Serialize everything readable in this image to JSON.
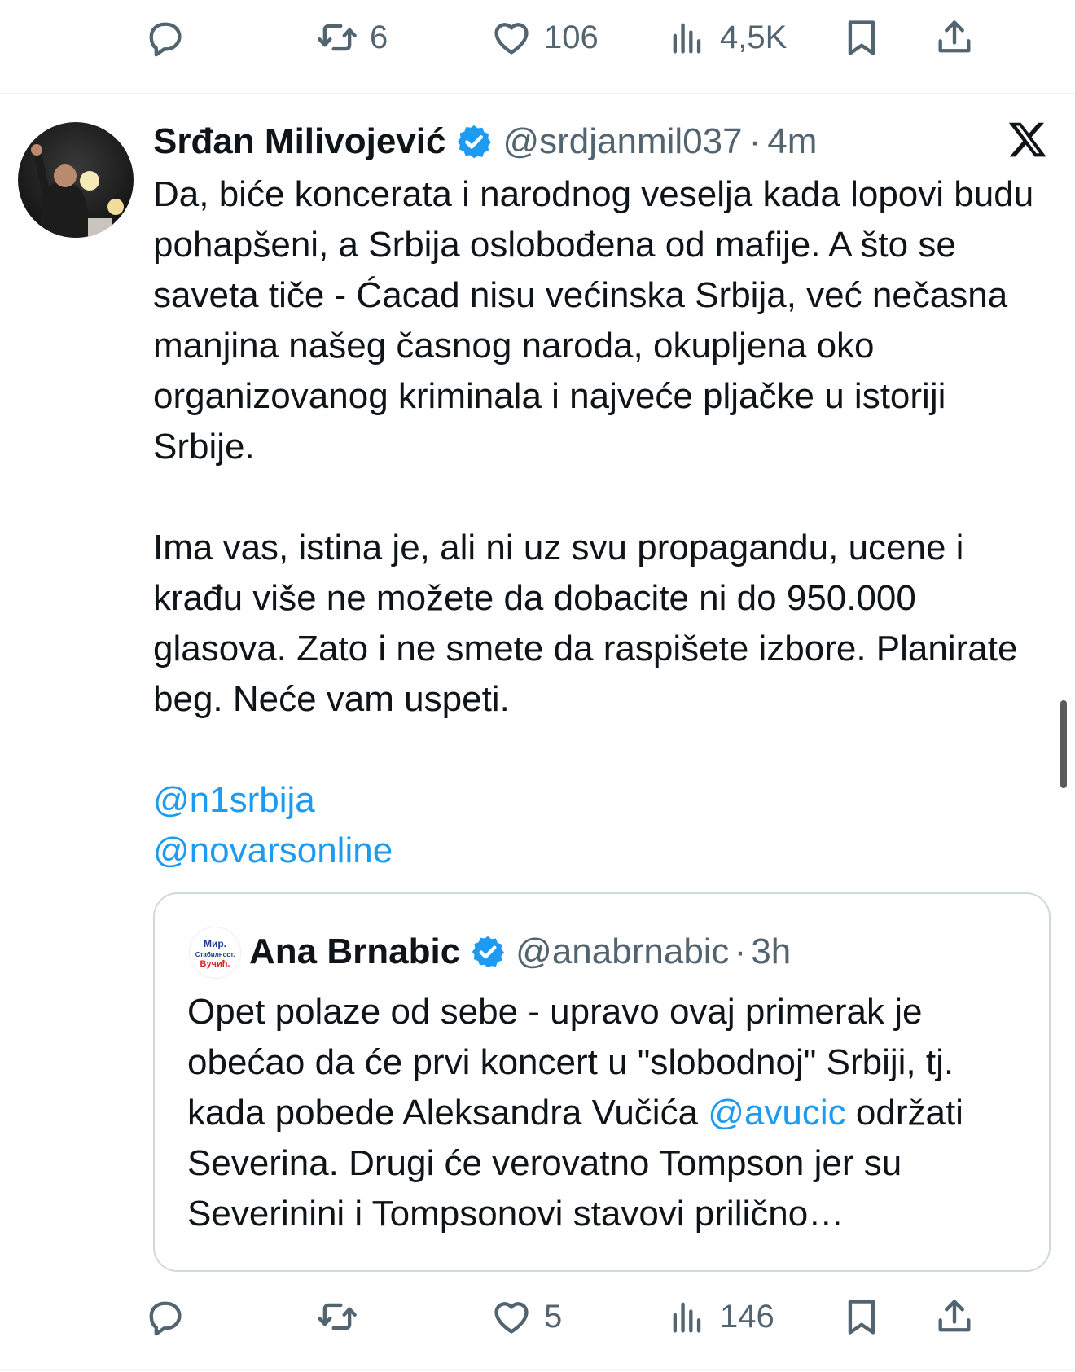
{
  "top_actions": {
    "reply_count": "",
    "retweet_count": "6",
    "like_count": "106",
    "views_count": "4,5K"
  },
  "tweet": {
    "author_name": "Srđan Milivojević",
    "handle": "@srdjanmil037",
    "separator": "·",
    "time": "4m",
    "paragraph1": "Da, biće koncerata i narodnog veselja kada lopovi budu pohapšeni, a Srbija oslobođena od mafije. A što se saveta tiče - Ćacad nisu većinska Srbija, već nečasna manjina našeg časnog naroda, okupljena oko organizovanog kriminala i najveće pljačke u istoriji Srbije.",
    "paragraph2": "Ima vas, istina je, ali ni uz svu propagandu, ucene i krađu više ne možete da dobacite ni do 950.000 glasova. Zato i ne smete da raspišete izbore. Planirate beg. Neće vam uspeti.",
    "mention1": "@n1srbija",
    "mention2": "@novarsonline"
  },
  "quote": {
    "author_name": "Ana Brnabic",
    "handle": "@anabrnabic",
    "separator": "·",
    "time": "3h",
    "avatar_text": {
      "line1": "Мир.",
      "line2": "Стабилност.",
      "line3": "Вучић."
    },
    "text_before": "Opet polaze od sebe - upravo ovaj primerak je obećao da će prvi koncert u \"slobodnoj\" Srbiji, tj. kada pobede Aleksandra Vučića ",
    "mention": "@avucic",
    "text_after": " održati Severina. Drugi će verovatno Tompson jer su Severinini i Tompsonovi stavovi prilično…"
  },
  "bottom_actions": {
    "reply_count": "",
    "retweet_count": "",
    "like_count": "5",
    "views_count": "146"
  },
  "colors": {
    "accent": "#1d9bf0",
    "muted": "#536471",
    "text": "#0f1419",
    "border": "#cfd9de"
  },
  "icons": [
    "reply-icon",
    "retweet-icon",
    "like-icon",
    "views-icon",
    "bookmark-icon",
    "share-icon",
    "verified-badge-icon",
    "x-logo-icon"
  ]
}
